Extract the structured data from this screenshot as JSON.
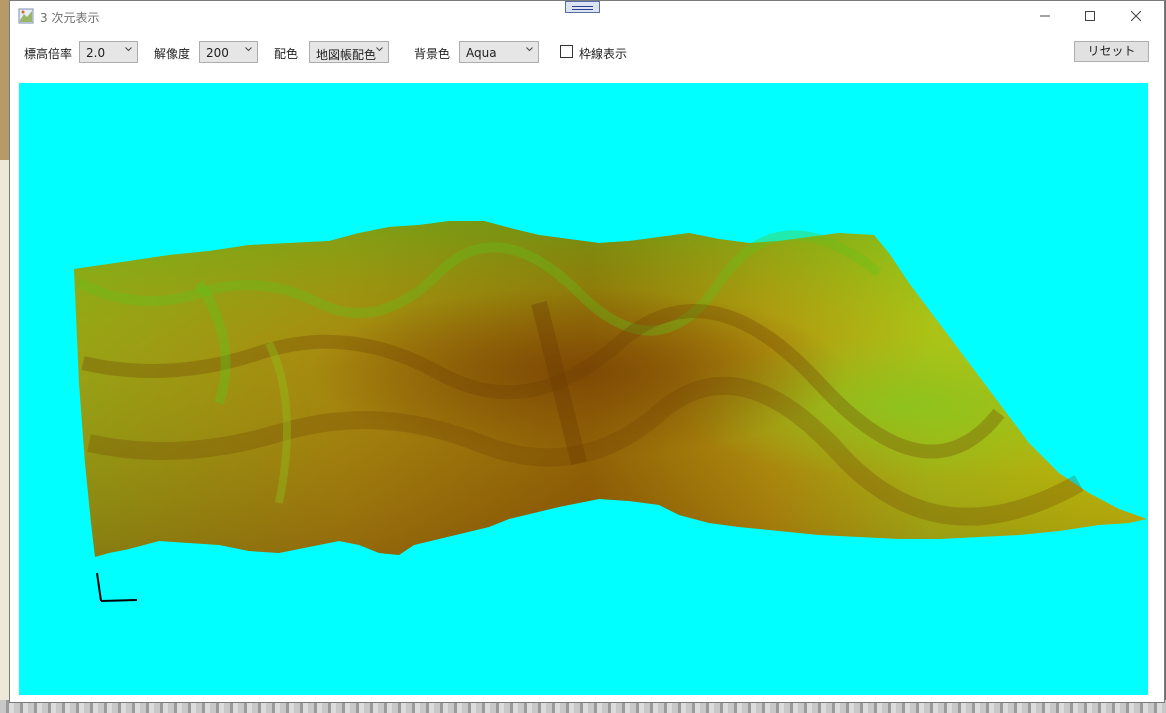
{
  "window": {
    "title": "3 次元表示"
  },
  "toolbar": {
    "elevation_scale_label": "標高倍率",
    "elevation_scale_value": "2.0",
    "resolution_label": "解像度",
    "resolution_value": "200",
    "color_scheme_label": "配色",
    "color_scheme_value": "地図帳配色",
    "background_color_label": "背景色",
    "background_color_value": "Aqua",
    "frame_lines_label": "枠線表示",
    "frame_lines_checked": false,
    "reset_label": "リセット"
  },
  "viewport": {
    "background": "#00ffff",
    "terrain_colors": {
      "low": "#5fc21a",
      "mid": "#c8c60a",
      "high": "#8a5206"
    }
  }
}
